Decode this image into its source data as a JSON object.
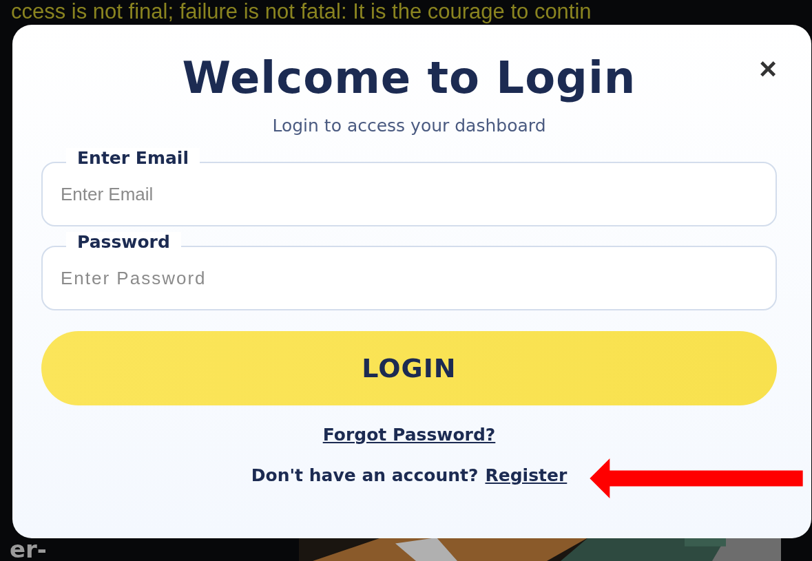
{
  "background": {
    "quote": "ccess is not final; failure is not fatal: It is the courage to contin",
    "heading": "er-"
  },
  "modal": {
    "title": "Welcome to Login",
    "subtitle": "Login to access your dashboard",
    "close": "×",
    "fields": [
      {
        "label": "Enter Email",
        "placeholder": "Enter Email",
        "kind": "email"
      },
      {
        "label": "Password",
        "placeholder": "Enter Password",
        "kind": "password"
      }
    ],
    "login_button": "LOGIN",
    "forgot_link": "Forgot Password?",
    "register_prompt": "Don't have an account?",
    "register_link": "Register"
  }
}
